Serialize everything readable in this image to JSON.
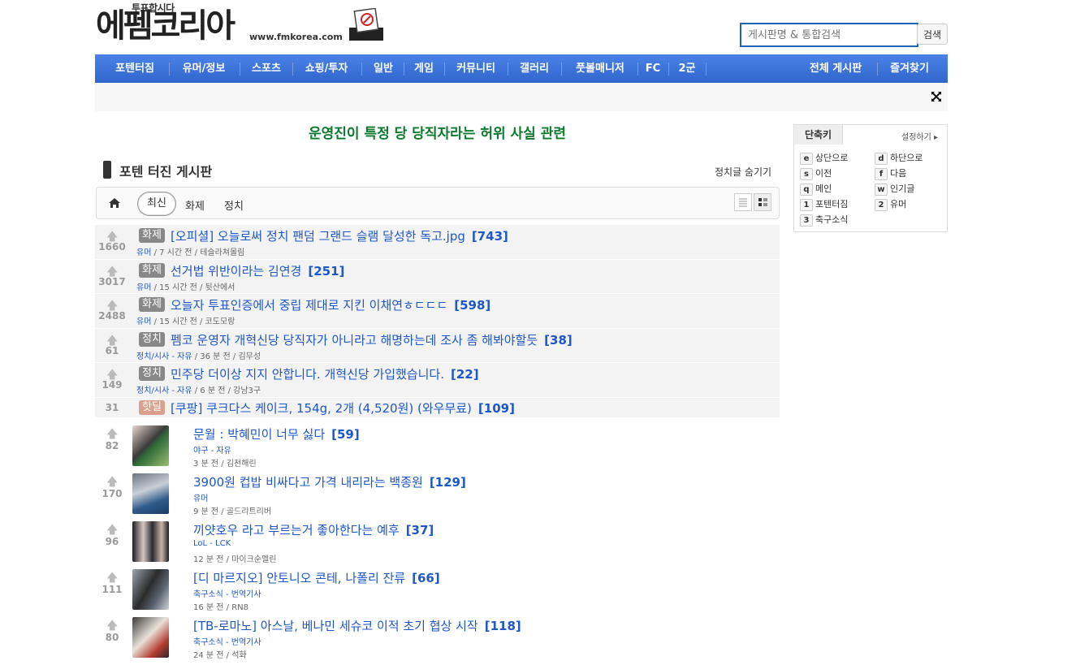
{
  "header": {
    "logo_small": "투표합시다",
    "logo_main": "에펨코리아",
    "logo_url": "www.fmkorea.com",
    "search_placeholder": "게시판명 & 통합검색",
    "search_button": "검색"
  },
  "nav": {
    "items": [
      "포텐터짐",
      "유머/정보",
      "스포츠",
      "쇼핑/투자",
      "일반",
      "게임",
      "커뮤니티",
      "갤러리",
      "풋볼매니저",
      "FC",
      "2군"
    ],
    "right_items": [
      "전체 게시판",
      "즐겨찾기"
    ]
  },
  "notice": "운영진이 특정 당 당직자라는 허위 사실 관련",
  "board": {
    "title": "포텐 터진 게시판",
    "hide_politics": "정치글 숨기기",
    "tabs": [
      "최신",
      "화제",
      "정치"
    ]
  },
  "posts": [
    {
      "votes": "1660",
      "badge": "화제",
      "title": "[오피셜] 오늘로써 정치 팬덤 그랜드 슬램 달성한 독고.jpg",
      "comments": "[743]",
      "cat": "유머",
      "time": " / 7 시간 전 / ",
      "author": "테슬라쳐몰림"
    },
    {
      "votes": "3017",
      "badge": "화제",
      "title": "선거법 위반이라는 김연경",
      "comments": "[251]",
      "cat": "유머",
      "time": " / 15 시간 전 / ",
      "author": "뒷산에서"
    },
    {
      "votes": "2488",
      "badge": "화제",
      "title": "오늘자 투표인증에서 중립 제대로 지킨 이채연ㅎㄷㄷㄷ",
      "comments": "[598]",
      "cat": "유머",
      "time": " / 15 시간 전 / ",
      "author": "코도모랑"
    },
    {
      "votes": "61",
      "badge": "정치",
      "title": "펨코 운영자 개혁신당 당직자가 아니라고 해명하는데 조사 좀 해봐야할듯",
      "comments": "[38]",
      "cat": "정치/시사 - 자유",
      "time": " / 36 분 전 / ",
      "author": "김무성"
    },
    {
      "votes": "149",
      "badge": "정치",
      "title": "민주당 더이상 지지 안합니다. 개혁신당 가입했습니다.",
      "comments": "[22]",
      "cat": "정치/시사 - 자유",
      "time": " / 6 분 전 / ",
      "author": "강남3구"
    }
  ],
  "hotdeal": {
    "votes": "31",
    "badge": "핫딜",
    "title": "[쿠팡] 쿠크다스 케이크, 154g, 2개 (4,520원) (와우무료)",
    "comments": "[109]"
  },
  "image_posts": [
    {
      "votes": "82",
      "title": "문월 : 박혜민이 너무 싫다",
      "comments": "[59]",
      "cat": "야구 - 자유",
      "meta": "3 분 전 / 김천해린"
    },
    {
      "votes": "170",
      "title": "3900원 컵밥 비싸다고 가격 내리라는 백종원",
      "comments": "[129]",
      "cat": "유머",
      "meta": "9 분 전 / 골드리트리버"
    },
    {
      "votes": "96",
      "title": "끼얏호우 라고 부르는거 좋아한다는 예후",
      "comments": "[37]",
      "cat": "LoL - LCK",
      "meta": "12 분 전 / 마이크순멜린"
    },
    {
      "votes": "111",
      "title": "[디 마르지오] 안토니오 콘테, 나폴리 잔류",
      "comments": "[66]",
      "cat": "축구소식 - 번역기사",
      "meta": "16 분 전 / RN8"
    },
    {
      "votes": "80",
      "title": "[TB-로마노] 아스날, 베나민 세슈코 이적 초기 협상 시작",
      "comments": "[118]",
      "cat": "축구소식 - 번역기사",
      "meta": "24 분 전 / 석화"
    }
  ],
  "shortcuts": {
    "tab": "단축키",
    "settings": "설정하기",
    "left": [
      {
        "key": "e",
        "label": "상단으로"
      },
      {
        "key": "s",
        "label": "이전"
      },
      {
        "key": "q",
        "label": "메인"
      },
      {
        "key": "1",
        "label": "포텐터짐"
      },
      {
        "key": "3",
        "label": "축구소식"
      }
    ],
    "right": [
      {
        "key": "d",
        "label": "하단으로"
      },
      {
        "key": "f",
        "label": "다음"
      },
      {
        "key": "w",
        "label": "인기글"
      },
      {
        "key": "2",
        "label": "유머"
      }
    ]
  },
  "colors": {
    "nav": "#3a6fd8",
    "link": "#1e57c9",
    "notice": "#0b7a2c"
  }
}
